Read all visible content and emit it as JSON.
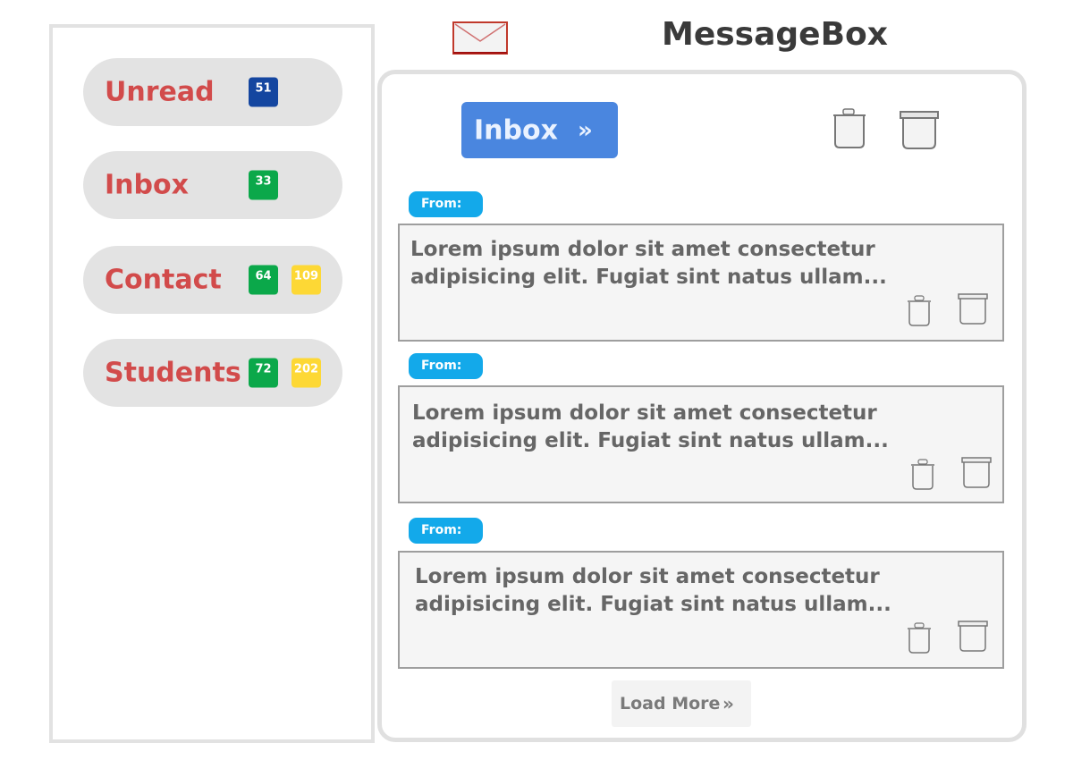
{
  "header": {
    "title": "MessageBox",
    "mail_icon": "envelope-icon"
  },
  "sidebar": {
    "items": [
      {
        "label": "Unread",
        "badges": [
          {
            "value": "51",
            "color": "#1446a0"
          }
        ]
      },
      {
        "label": "Inbox",
        "badges": [
          {
            "value": "33",
            "color": "#0ba84a"
          }
        ]
      },
      {
        "label": "Contact",
        "badges": [
          {
            "value": "64",
            "color": "#0ba84a"
          },
          {
            "value": "109",
            "color": "#fdd835"
          }
        ]
      },
      {
        "label": "Students",
        "badges": [
          {
            "value": "72",
            "color": "#0ba84a"
          },
          {
            "value": "202",
            "color": "#fdd835"
          }
        ]
      }
    ]
  },
  "main": {
    "folder_button": {
      "label": "Inbox",
      "chevron": "»",
      "icon": "double-chevron-right-icon"
    },
    "toolbar_icons": [
      "trash-icon",
      "archive-icon"
    ],
    "messages": [
      {
        "from_label": "From:",
        "text": "Lorem ipsum dolor sit amet consectetur adipisicing elit. Fugiat sint natus ullam..."
      },
      {
        "from_label": "From:",
        "text": "Lorem ipsum dolor sit amet consectetur adipisicing elit. Fugiat sint natus ullam..."
      },
      {
        "from_label": "From:",
        "text": "Lorem ipsum dolor sit amet consectetur adipisicing elit. Fugiat sint natus ullam..."
      }
    ],
    "load_more": {
      "label": "Load More",
      "chevron": "»"
    }
  },
  "colors": {
    "accent_blue": "#4a86df",
    "from_tag": "#13a9ea",
    "nav_label": "#d24b4b"
  }
}
